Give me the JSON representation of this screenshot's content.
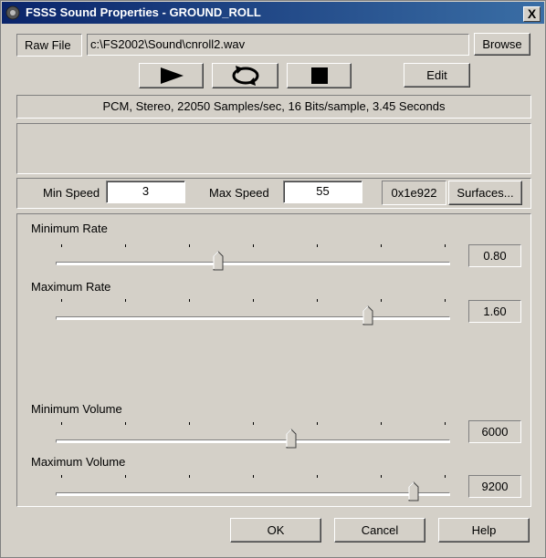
{
  "window": {
    "title": "FSSS Sound Properties - GROUND_ROLL",
    "close_label": "X"
  },
  "file": {
    "raw_file_label": "Raw File",
    "path": "c:\\FS2002\\Sound\\cnroll2.wav",
    "browse_label": "Browse"
  },
  "transport": {
    "edit_label": "Edit"
  },
  "info": "PCM, Stereo, 22050 Samples/sec, 16 Bits/sample, 3.45 Seconds",
  "speed": {
    "min_label": "Min Speed",
    "min_value": "3",
    "max_label": "Max Speed",
    "max_value": "55",
    "hex_value": "0x1e922",
    "surfaces_label": "Surfaces..."
  },
  "sliders": [
    {
      "label": "Minimum Rate",
      "value_text": "0.80",
      "position": 0.41
    },
    {
      "label": "Maximum Rate",
      "value_text": "1.60",
      "position": 0.8
    },
    {
      "label": "Minimum Volume",
      "value_text": "6000",
      "position": 0.6
    },
    {
      "label": "Maximum Volume",
      "value_text": "9200",
      "position": 0.92
    }
  ],
  "footer": {
    "ok_label": "OK",
    "cancel_label": "Cancel",
    "help_label": "Help"
  }
}
